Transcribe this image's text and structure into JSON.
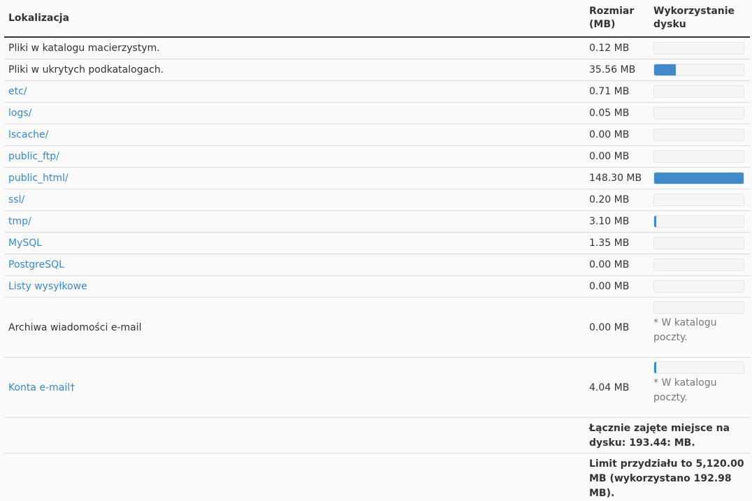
{
  "table": {
    "headers": {
      "location": "Lokalizacja",
      "size": "Rozmiar (MB)",
      "usage": "Wykorzystanie dysku"
    },
    "rows": [
      {
        "name": "Pliki w katalogu macierzystym.",
        "size": "0.12 MB",
        "usage": 0.0,
        "link": false
      },
      {
        "name": "Pliki w ukrytych podkatalogach.",
        "size": "35.56 MB",
        "usage": 0.24,
        "link": false
      },
      {
        "name": "etc/",
        "size": "0.71 MB",
        "usage": 0.0,
        "link": true
      },
      {
        "name": "logs/",
        "size": "0.05 MB",
        "usage": 0.0,
        "link": true
      },
      {
        "name": "lscache/",
        "size": "0.00 MB",
        "usage": 0.0,
        "link": true
      },
      {
        "name": "public_ftp/",
        "size": "0.00 MB",
        "usage": 0.0,
        "link": true
      },
      {
        "name": "public_html/",
        "size": "148.30 MB",
        "usage": 1.0,
        "link": true
      },
      {
        "name": "ssl/",
        "size": "0.20 MB",
        "usage": 0.0,
        "link": true
      },
      {
        "name": "tmp/",
        "size": "3.10 MB",
        "usage": 0.02,
        "link": true
      },
      {
        "name": "MySQL",
        "size": "1.35 MB",
        "usage": 0.0,
        "link": true
      },
      {
        "name": "PostgreSQL",
        "size": "0.00 MB",
        "usage": 0.0,
        "link": true
      },
      {
        "name": "Listy wysyłkowe",
        "size": "0.00 MB",
        "usage": 0.0,
        "link": true
      },
      {
        "name": "Archiwa wiadomości e-mail",
        "size": "0.00 MB",
        "usage": 0.0,
        "link": false,
        "note": "* W katalogu poczty."
      },
      {
        "name": "Konta e-mail†",
        "size": "4.04 MB",
        "usage": 0.02,
        "link": true,
        "note": "* W katalogu poczty."
      }
    ],
    "total": "Łącznie zajęte miejsce na dysku: 193.44: MB.",
    "limit": "Limit przydziału to 5,120.00 MB (wykorzystano 192.98 MB)."
  },
  "colors": {
    "link": "#3a87c8",
    "bar_fill": "#4289c9",
    "bar_bg": "#f5f5f5"
  }
}
